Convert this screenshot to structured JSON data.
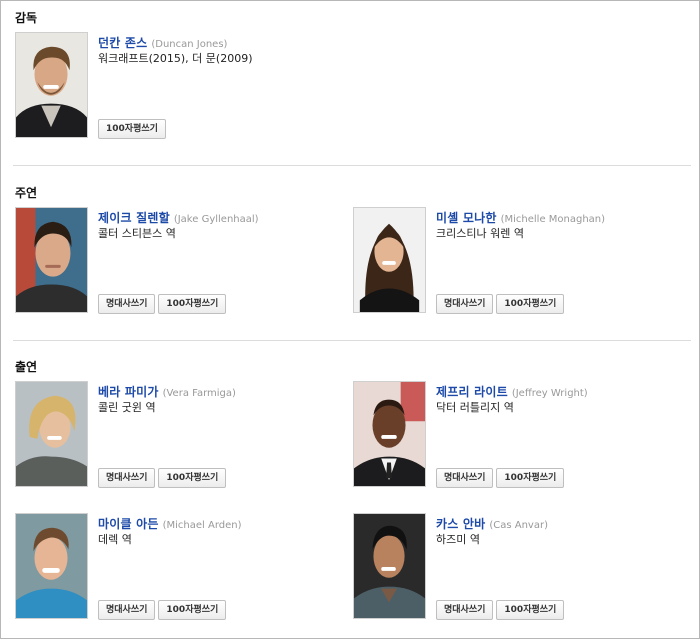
{
  "sections": {
    "director": {
      "title": "감독"
    },
    "lead": {
      "title": "주연"
    },
    "support": {
      "title": "출연"
    }
  },
  "buttons": {
    "quote": "명대사쓰기",
    "review": "100자평쓰기"
  },
  "people": {
    "director": {
      "name_ko": "던칸 존스",
      "name_en": "(Duncan Jones)",
      "role": "워크래프트(2015), 더 문(2009)"
    },
    "jake": {
      "name_ko": "제이크 질렌할",
      "name_en": "(Jake Gyllenhaal)",
      "role": "콜터 스티븐스 역"
    },
    "michelle": {
      "name_ko": "미셸 모나한",
      "name_en": "(Michelle Monaghan)",
      "role": "크리스티나 워렌 역"
    },
    "vera": {
      "name_ko": "베라 파미가",
      "name_en": "(Vera Farmiga)",
      "role": "콜린 굿윈 역"
    },
    "jeffrey": {
      "name_ko": "제프리 라이트",
      "name_en": "(Jeffrey Wright)",
      "role": "닥터 러틀리지 역"
    },
    "michael": {
      "name_ko": "마이클 아든",
      "name_en": "(Michael Arden)",
      "role": "데렉 역"
    },
    "cas": {
      "name_ko": "카스 안바",
      "name_en": "(Cas Anvar)",
      "role": "하즈미 역"
    }
  }
}
